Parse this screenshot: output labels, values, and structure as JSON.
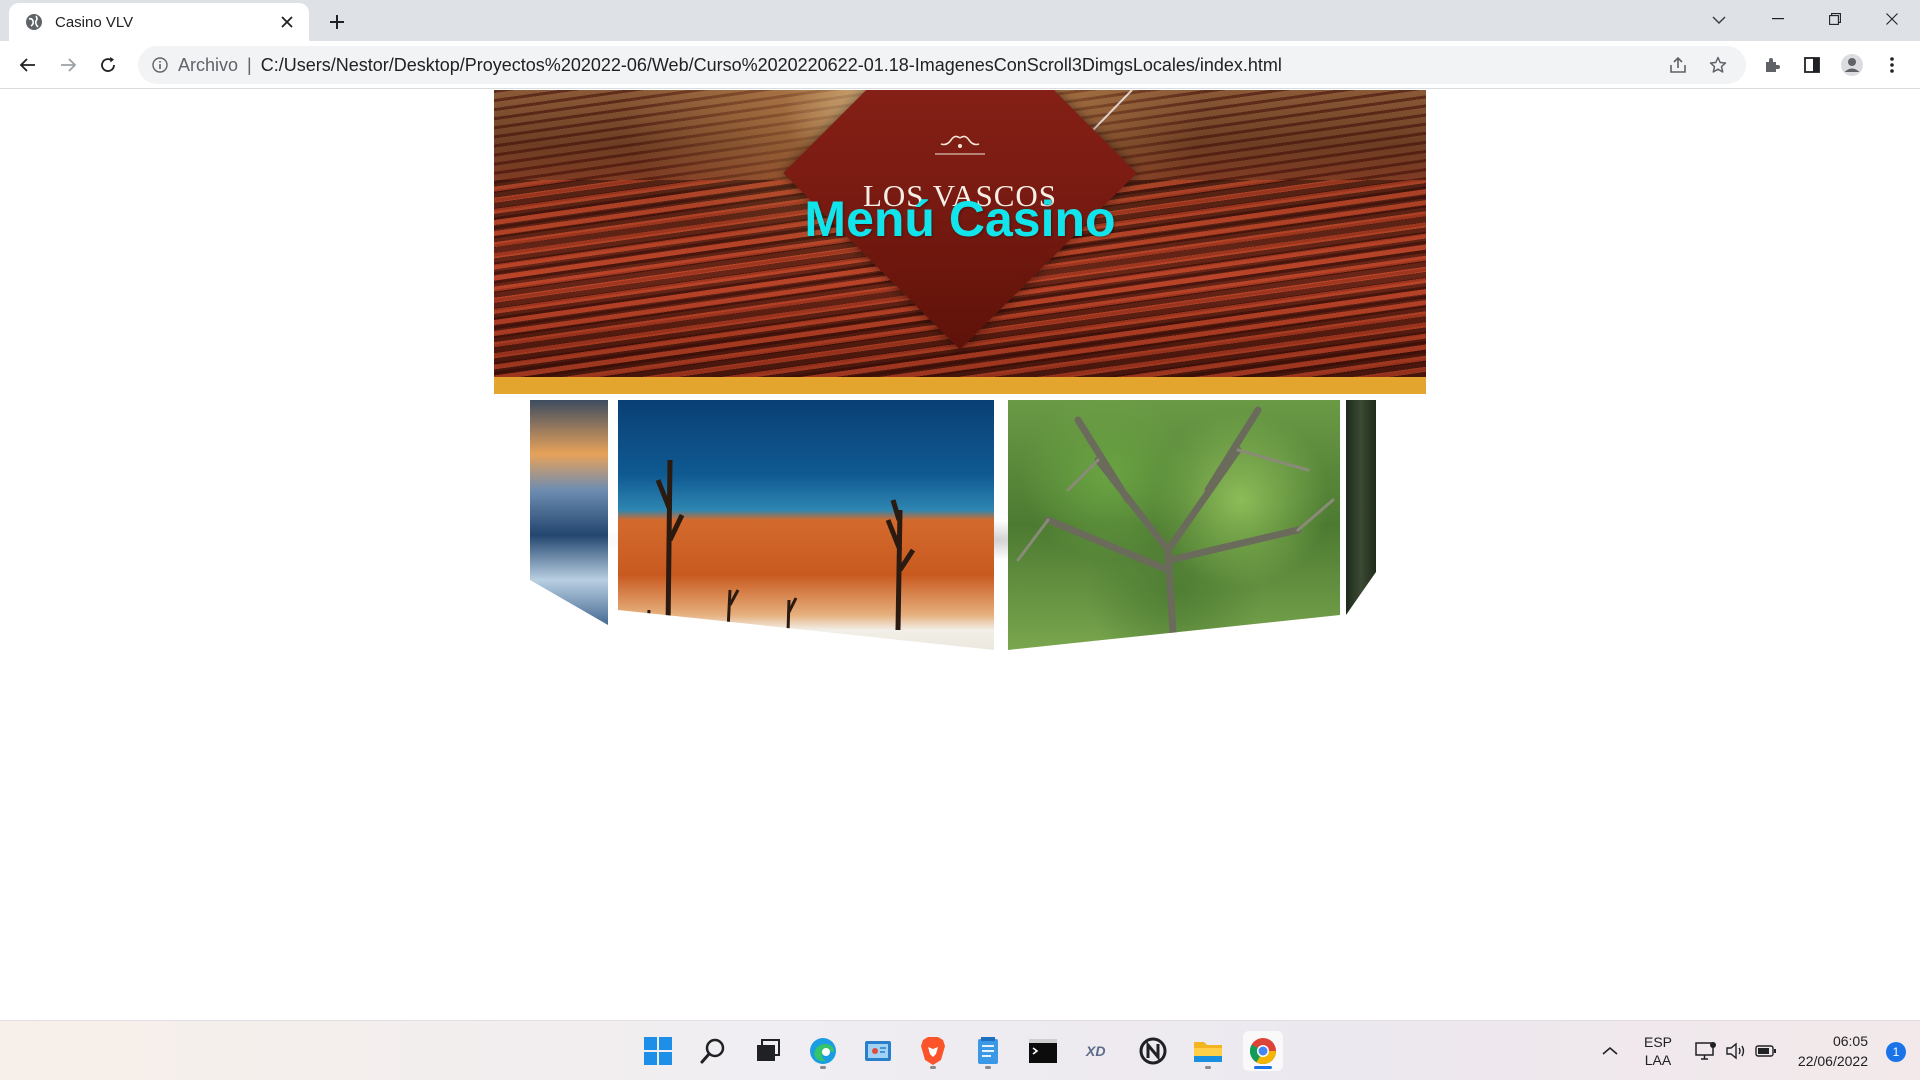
{
  "browser": {
    "tab": {
      "title": "Casino VLV"
    },
    "omnibox": {
      "scheme_label": "Archivo",
      "separator": "|",
      "url": "C:/Users/Nestor/Desktop/Proyectos%202022-06/Web/Curso%2020220622-01.18-ImagenesConScroll3DimgsLocales/index.html"
    }
  },
  "page": {
    "logo_text": "LOS VASCOS",
    "title": "Menú Casino",
    "carousel": [
      "mountain-lake-image",
      "desert-dunes-image",
      "banyan-tree-image",
      "tree-bark-image"
    ]
  },
  "taskbar": {
    "language": {
      "line1": "ESP",
      "line2": "LAA"
    },
    "clock": {
      "time": "06:05",
      "date": "22/06/2022"
    },
    "notifications": "1"
  },
  "colors": {
    "title_cyan": "#12e4ec",
    "diamond_red": "#7a1b12",
    "gold_stripe": "#e3a52d",
    "accent_blue": "#1a73e8"
  }
}
